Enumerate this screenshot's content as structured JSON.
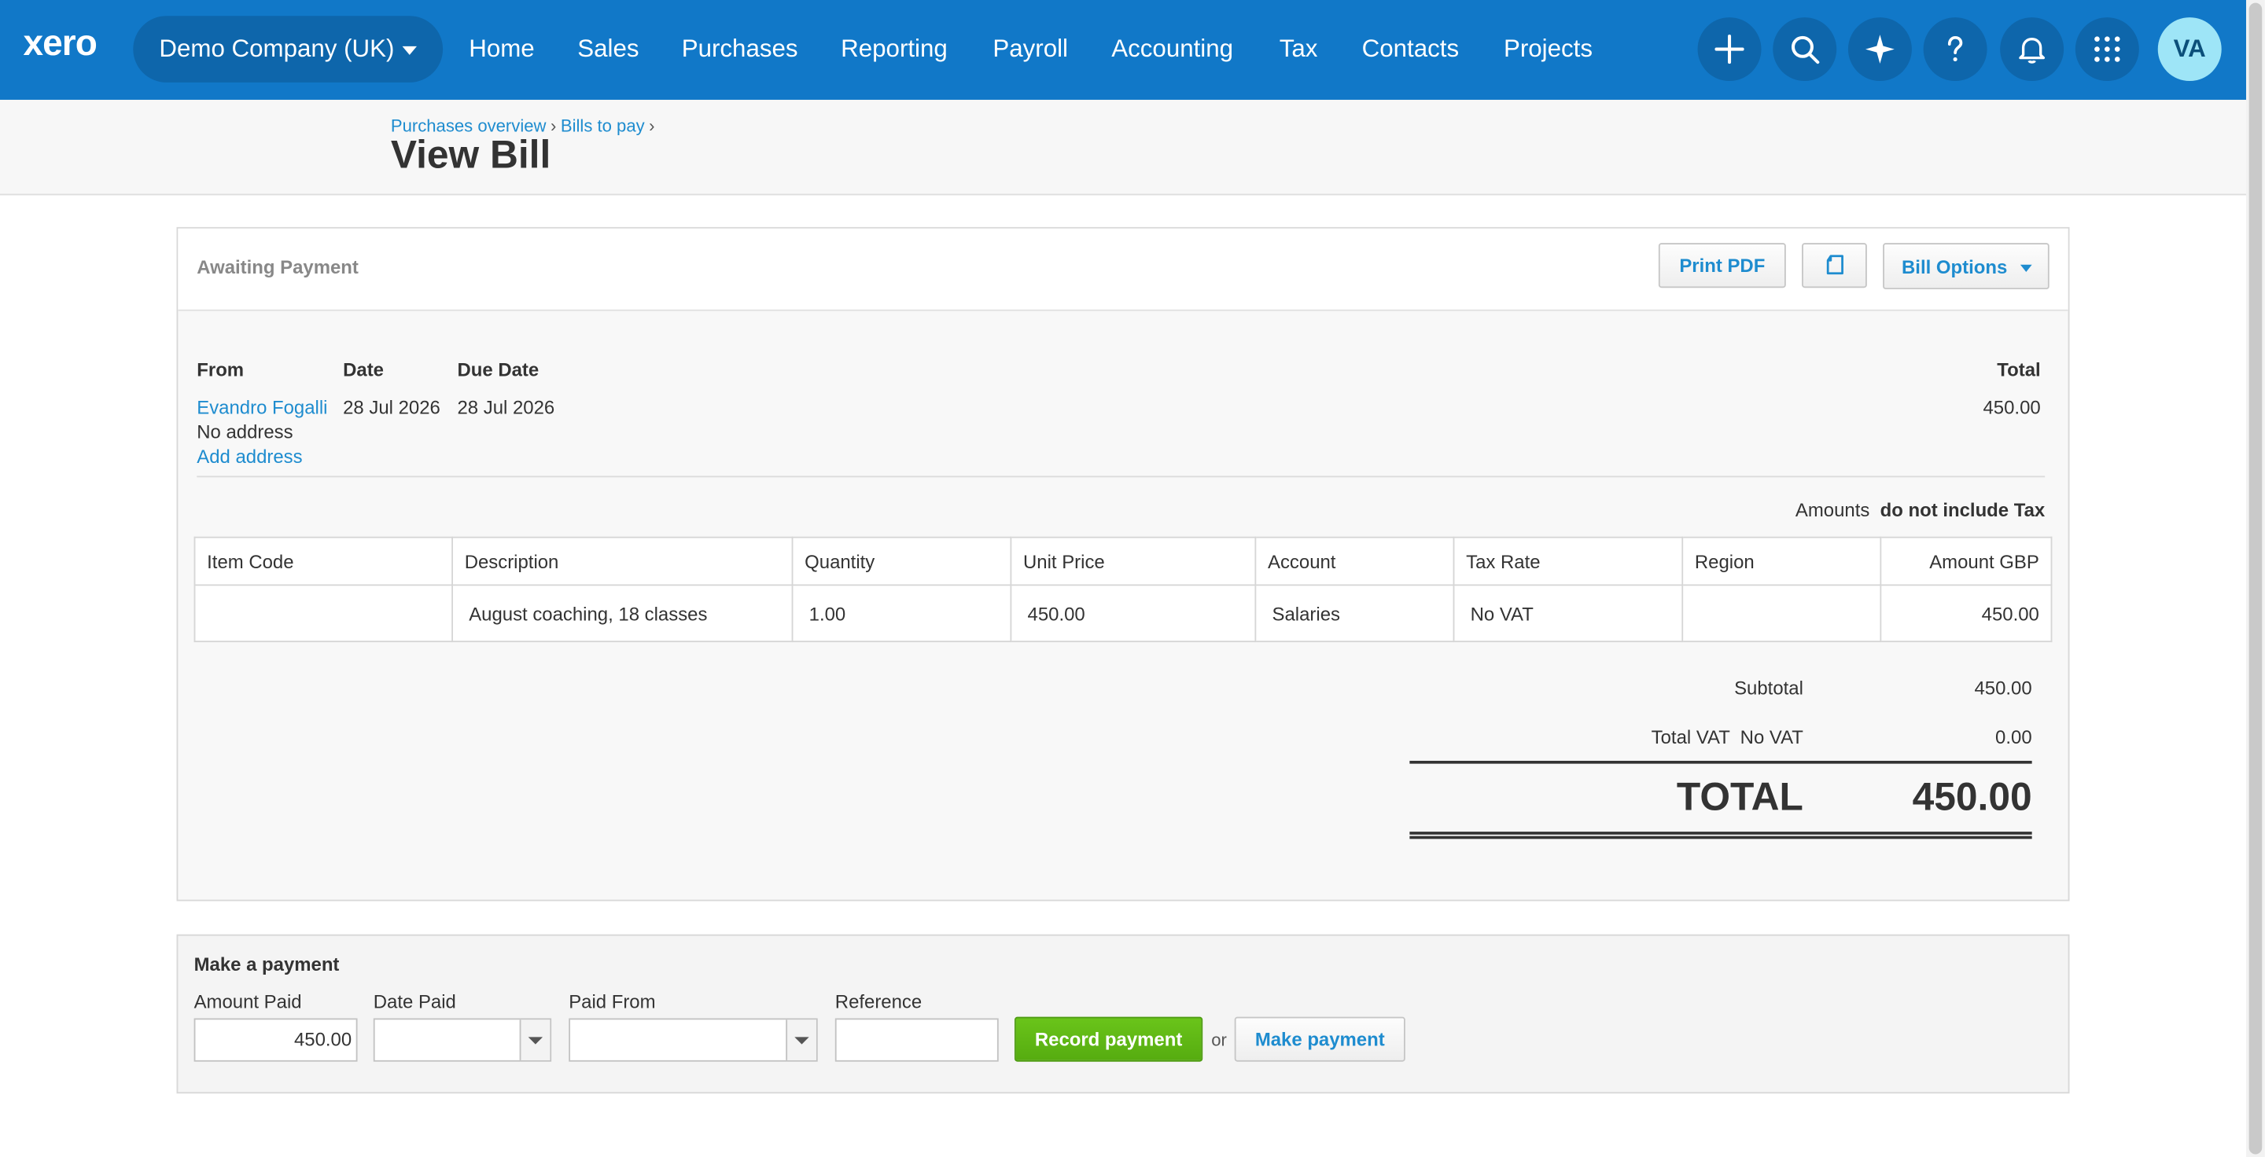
{
  "topbar": {
    "logo": "xero",
    "organisation": "Demo Company (UK)",
    "nav": [
      "Home",
      "Sales",
      "Purchases",
      "Reporting",
      "Payroll",
      "Accounting",
      "Tax",
      "Contacts",
      "Projects"
    ],
    "icons": [
      "plus-icon",
      "search-icon",
      "sparkle-icon",
      "help-icon",
      "bell-icon",
      "apps-grid-icon"
    ],
    "avatar_initials": "VA",
    "bar_color": "#1178c8"
  },
  "breadcrumb": {
    "items": [
      "Purchases overview",
      "Bills to pay"
    ],
    "separator": "›"
  },
  "page_title": "View Bill",
  "bill": {
    "status": "Awaiting Payment",
    "actions": {
      "print_pdf": "Print PDF",
      "copy_icon": "copy-icon",
      "bill_options": "Bill Options"
    },
    "labels": {
      "from": "From",
      "date": "Date",
      "due_date": "Due Date",
      "total": "Total"
    },
    "from_name": "Evandro Fogalli",
    "no_address": "No address",
    "add_address": "Add address",
    "date": "28 Jul 2026",
    "due_date": "28 Jul 2026",
    "total": "450.00",
    "tax_note": {
      "prefix": "Amounts",
      "mode": "do not include Tax"
    },
    "columns": [
      "Item Code",
      "Description",
      "Quantity",
      "Unit Price",
      "Account",
      "Tax Rate",
      "Region",
      "Amount GBP"
    ],
    "line_items": [
      {
        "item_code": "",
        "description": "August coaching, 18 classes",
        "quantity": "1.00",
        "unit_price": "450.00",
        "account": "Salaries",
        "tax_rate": "No VAT",
        "region": "",
        "amount": "450.00"
      }
    ],
    "subtotal_label": "Subtotal",
    "subtotal": "450.00",
    "vat_label": "Total VAT  No VAT",
    "vat": "0.00",
    "grand_total_label": "TOTAL",
    "grand_total": "450.00"
  },
  "payment": {
    "heading": "Make a payment",
    "amount_label": "Amount Paid",
    "amount_value": "450.00",
    "date_label": "Date Paid",
    "date_value": "",
    "paid_from_label": "Paid From",
    "paid_from_value": "",
    "reference_label": "Reference",
    "reference_value": "",
    "record_button": "Record payment",
    "or_text": "or",
    "make_button": "Make payment",
    "record_color": "#5cb614"
  }
}
